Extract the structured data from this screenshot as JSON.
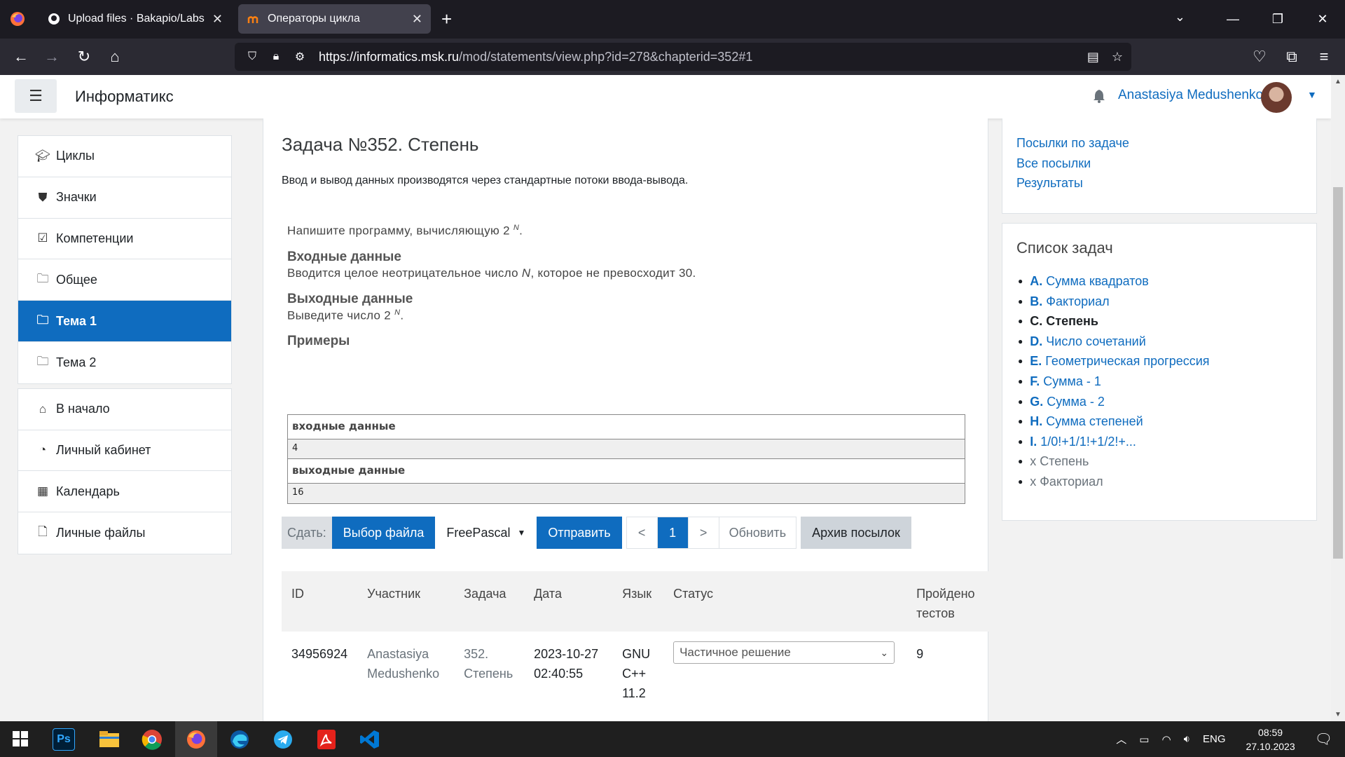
{
  "browser": {
    "tabs": [
      {
        "title": "Upload files · Bakapio/Labs",
        "icon": "github-icon",
        "active": false
      },
      {
        "title": "Операторы цикла",
        "icon": "moodle-icon",
        "active": true
      }
    ],
    "new_tab": "+",
    "url_host": "https://informatics.msk.ru",
    "url_path": "/mod/statements/view.php?id=278&chapterid=352#1"
  },
  "header": {
    "menu_icon": "☰",
    "site_name": "Информатикс",
    "user_name": "Anastasiya Medushenko"
  },
  "leftnav": {
    "group1": [
      {
        "label": "Циклы",
        "icon": "graduation-cap-icon"
      },
      {
        "label": "Значки",
        "icon": "shield-icon"
      },
      {
        "label": "Компетенции",
        "icon": "checkbox-icon"
      },
      {
        "label": "Общее",
        "icon": "folder-icon"
      },
      {
        "label": "Тема 1",
        "icon": "folder-icon",
        "active": true
      },
      {
        "label": "Тема 2",
        "icon": "folder-icon"
      }
    ],
    "group2": [
      {
        "label": "В начало",
        "icon": "home-icon"
      },
      {
        "label": "Личный кабинет",
        "icon": "dashboard-icon"
      },
      {
        "label": "Календарь",
        "icon": "calendar-icon"
      },
      {
        "label": "Личные файлы",
        "icon": "file-icon"
      }
    ]
  },
  "task": {
    "title": "Задача №352. Степень",
    "io_note": "Ввод и вывод данных производятся через стандартные потоки ввода-вывода.",
    "statement_prefix": "Напишите программу, вычисляющую 2",
    "statement_sup": "N",
    "statement_suffix": ".",
    "input_heading": "Входные данные",
    "input_prefix": "Вводится целое неотрицательное число ",
    "input_var": "N",
    "input_suffix": ", которое не превосходит 30.",
    "output_heading": "Выходные данные",
    "output_prefix": "Выведите число 2",
    "output_sup": "N",
    "output_suffix": ".",
    "examples_heading": "Примеры",
    "sample_input_header": "входные данные",
    "sample_input": "4",
    "sample_output_header": "выходные данные",
    "sample_output": "16"
  },
  "submit": {
    "label": "Сдать:",
    "choose_file": "Выбор файла",
    "language": "FreePascal",
    "send": "Отправить",
    "prev": "<",
    "page": "1",
    "next": ">",
    "refresh": "Обновить",
    "archive": "Архив посылок"
  },
  "submissions": {
    "headers": [
      "ID",
      "Участник",
      "Задача",
      "Дата",
      "Язык",
      "Статус",
      "Пройдено тестов"
    ],
    "rows": [
      {
        "id": "34956924",
        "participant": "Anastasiya Medushenko",
        "problem": "352. Степень",
        "date": "2023-10-27 02:40:55",
        "language": "GNU C++ 11.2",
        "status": "Частичное решение",
        "tests_passed": "9"
      }
    ]
  },
  "right": {
    "links": [
      "Посылки по задаче",
      "Все посылки",
      "Результаты"
    ],
    "problem_list_title": "Список задач",
    "problems": [
      {
        "letter": "A.",
        "name": "Сумма квадратов"
      },
      {
        "letter": "B.",
        "name": "Факториал"
      },
      {
        "letter": "C.",
        "name": "Степень",
        "current": true
      },
      {
        "letter": "D.",
        "name": "Число сочетаний"
      },
      {
        "letter": "E.",
        "name": "Геометрическая прогрессия"
      },
      {
        "letter": "F.",
        "name": "Сумма - 1"
      },
      {
        "letter": "G.",
        "name": "Сумма - 2"
      },
      {
        "letter": "H.",
        "name": "Сумма степеней"
      },
      {
        "letter": "I.",
        "name": "1/0!+1/1!+1/2!+..."
      }
    ],
    "extras": [
      "x Степень",
      "x Факториал"
    ]
  },
  "taskbar": {
    "lang": "ENG",
    "time": "08:59",
    "date": "27.10.2023",
    "apps": [
      "photoshop-icon",
      "file-explorer-icon",
      "chrome-icon",
      "firefox-icon",
      "edge-icon",
      "telegram-icon",
      "acrobat-icon",
      "vscode-icon"
    ]
  },
  "colors": {
    "accent": "#0f6cbf",
    "browser_dark": "#1c1b22",
    "browser_toolbar": "#2b2a33"
  }
}
